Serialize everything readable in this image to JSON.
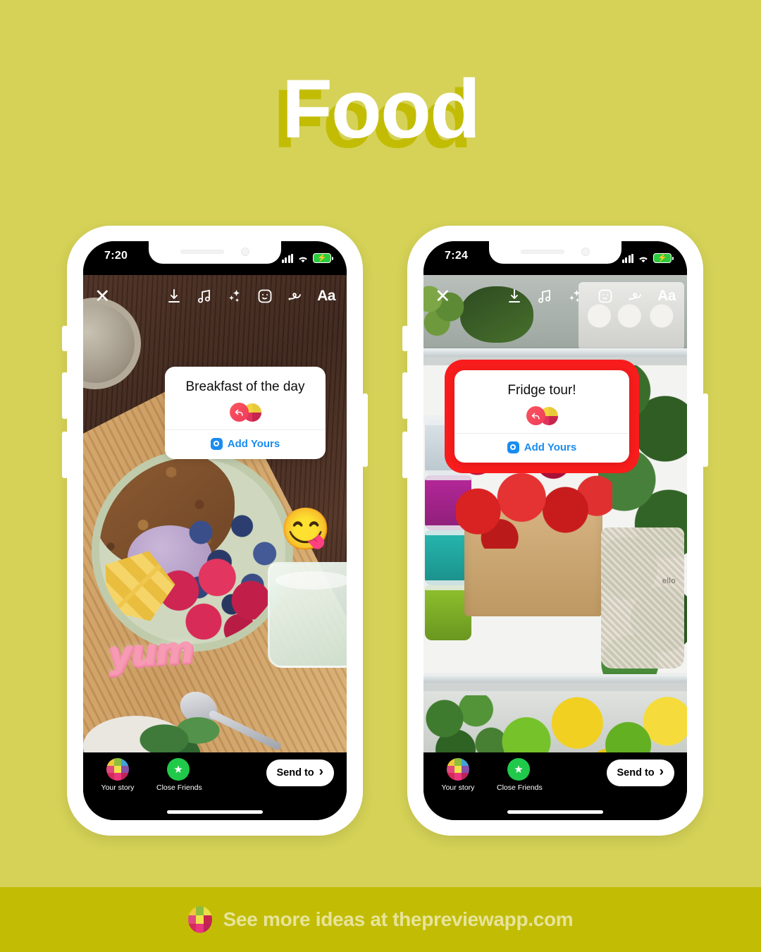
{
  "theme": {
    "background": "#d5d257",
    "title_shadow": "#c2bc05",
    "footer_band": "#c2bc05",
    "footer_text_color": "#e7e49a",
    "highlight_red": "#f81c1c",
    "add_yours_blue": "#1a8cf0",
    "close_friends_green": "#21c94a"
  },
  "header": {
    "title": "Food"
  },
  "phones": [
    {
      "id": "phone-left",
      "status": {
        "time": "7:20",
        "signal_icon": "cellular-signal-icon",
        "wifi_icon": "wifi-icon",
        "battery_icon": "battery-charging-icon"
      },
      "toolbar": {
        "close_label": "✕",
        "icons": [
          "download-icon",
          "music-note-icon",
          "sparkles-icon",
          "sticker-smiley-icon",
          "draw-squiggle-icon"
        ],
        "text_tool_label": "Aa"
      },
      "sticker": {
        "title": "Breakfast of the day",
        "add_yours_label": "Add Yours",
        "camera_icon": "camera-icon",
        "logo_icon": "add-yours-reply-icon",
        "highlighted": false
      },
      "decorations": [
        {
          "name": "yummy-face-emoji",
          "value": "😋"
        },
        {
          "name": "yum-text-sticker",
          "value": "yum"
        }
      ],
      "bottom_bar": {
        "your_story_label": "Your story",
        "close_friends_label": "Close Friends",
        "send_to_label": "Send to",
        "send_to_chevron": "›"
      },
      "photo_description": "smoothie-bowl-on-wood-board"
    },
    {
      "id": "phone-right",
      "status": {
        "time": "7:24",
        "signal_icon": "cellular-signal-icon",
        "wifi_icon": "wifi-icon",
        "battery_icon": "battery-charging-icon"
      },
      "toolbar": {
        "close_label": "✕",
        "icons": [
          "download-icon",
          "music-note-icon",
          "sparkles-icon",
          "sticker-smiley-icon",
          "draw-squiggle-icon"
        ],
        "text_tool_label": "Aa"
      },
      "sticker": {
        "title": "Fridge tour!",
        "add_yours_label": "Add Yours",
        "camera_icon": "camera-icon",
        "logo_icon": "add-yours-reply-icon",
        "highlighted": true
      },
      "decorations": [],
      "bottom_bar": {
        "your_story_label": "Your story",
        "close_friends_label": "Close Friends",
        "send_to_label": "Send to",
        "send_to_chevron": "›"
      },
      "photo_description": "open-fridge-with-produce"
    }
  ],
  "footer": {
    "logo_icon": "preview-app-grid-logo",
    "text": "See more ideas at thepreviewapp.com"
  }
}
